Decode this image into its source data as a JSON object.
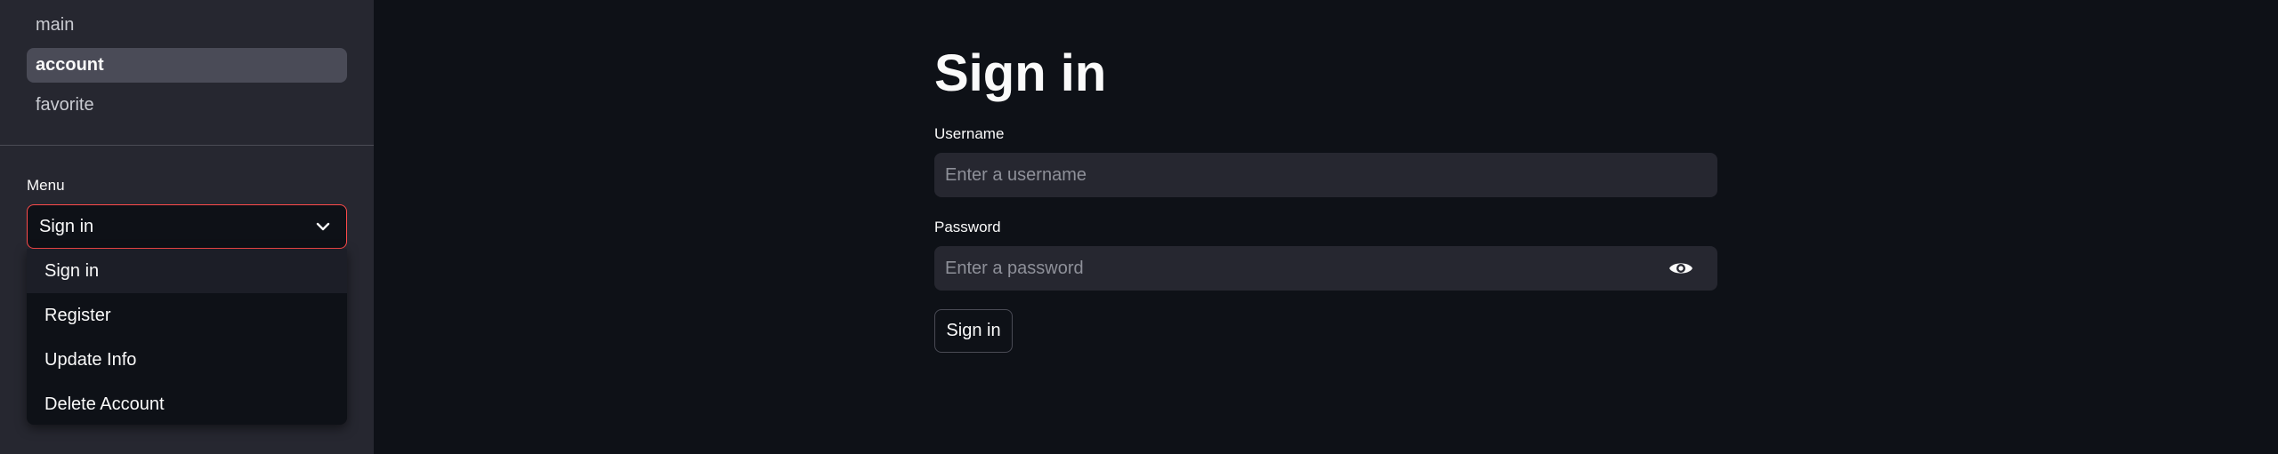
{
  "sidebar": {
    "nav": [
      {
        "label": "main"
      },
      {
        "label": "account"
      },
      {
        "label": "favorite"
      }
    ],
    "active_nav": "account",
    "menu": {
      "label": "Menu",
      "selected": "Sign in",
      "options": [
        "Sign in",
        "Register",
        "Update Info",
        "Delete Account"
      ]
    }
  },
  "main": {
    "title": "Sign in",
    "username": {
      "label": "Username",
      "placeholder": "Enter a username",
      "value": ""
    },
    "password": {
      "label": "Password",
      "placeholder": "Enter a password",
      "value": ""
    },
    "submit_label": "Sign in"
  },
  "colors": {
    "background": "#0e1117",
    "sidebar": "#262730",
    "accent": "#ff4b4b",
    "input_bg": "#262730"
  },
  "icons": {
    "dropdown": "chevron-down-icon",
    "password_toggle": "eye-icon"
  }
}
